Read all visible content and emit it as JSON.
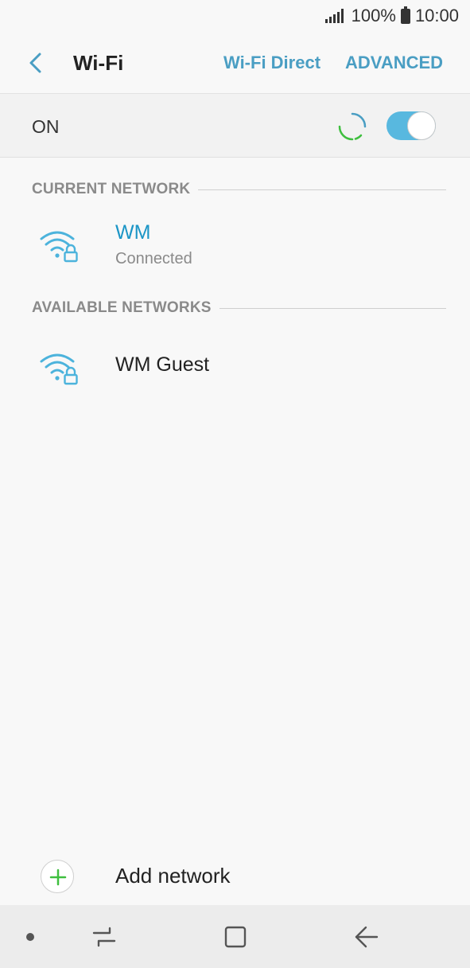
{
  "status_bar": {
    "battery": "100%",
    "time": "10:00",
    "icons": [
      "signal-icon",
      "battery-icon"
    ]
  },
  "app_bar": {
    "title": "Wi-Fi",
    "wifi_direct_label": "Wi-Fi Direct",
    "advanced_label": "ADVANCED",
    "back_icon": "back-arrow-icon"
  },
  "toggle": {
    "label": "ON",
    "state": true,
    "spinner_icon": "loading-spinner-icon"
  },
  "current_network": {
    "header": "CURRENT NETWORK",
    "name": "WM",
    "status": "Connected",
    "icon": "wifi-locked-icon"
  },
  "available_networks": {
    "header": "AVAILABLE NETWORKS",
    "items": [
      {
        "name": "WM Guest",
        "icon": "wifi-locked-icon"
      }
    ]
  },
  "add_network": {
    "label": "Add network",
    "icon": "plus-icon"
  },
  "nav_bar": {
    "icons": [
      "nav-dot-icon",
      "recent-apps-icon",
      "home-icon",
      "back-icon"
    ]
  },
  "colors": {
    "accent": "#1b95c6",
    "header_link": "#4a9ec3",
    "toggle_on": "#58b8df",
    "add_green": "#3fbf3f"
  }
}
